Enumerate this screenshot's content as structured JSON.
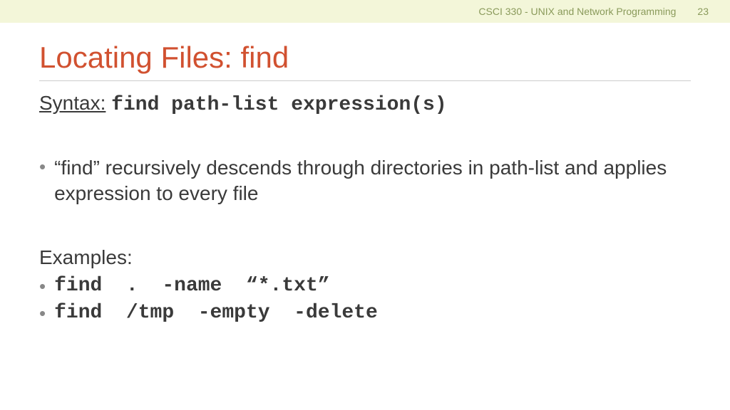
{
  "header": {
    "course": "CSCI 330 - UNIX and Network Programming",
    "page": "23"
  },
  "title": "Locating Files: find",
  "syntax": {
    "label": "Syntax:",
    "command": "find  path-list  expression(s)"
  },
  "bullets": [
    "“find” recursively descends through directories in path-list and applies expression to every file"
  ],
  "examples": {
    "label": "Examples:",
    "items": [
      "find  .  -name  “*.txt”",
      "find  /tmp  -empty  -delete"
    ]
  }
}
